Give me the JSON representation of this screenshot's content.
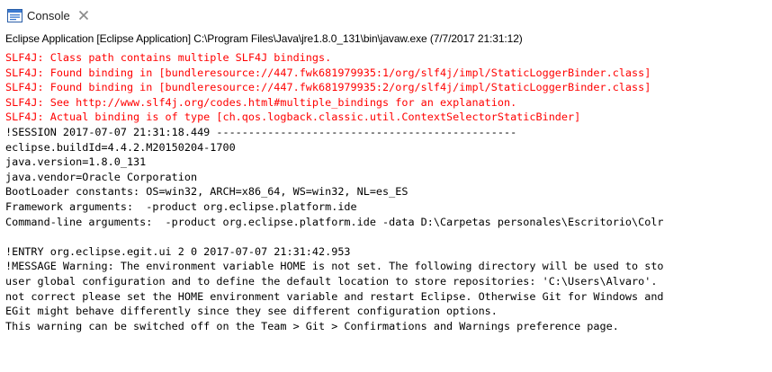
{
  "view": {
    "tab_label": "Console",
    "launch_info": "Eclipse Application [Eclipse Application] C:\\Program Files\\Java\\jre1.8.0_131\\bin\\javaw.exe (7/7/2017 21:31:12)"
  },
  "console": {
    "lines": [
      "SLF4J: Class path contains multiple SLF4J bindings.",
      "SLF4J: Found binding in [bundleresource://447.fwk681979935:1/org/slf4j/impl/StaticLoggerBinder.class]",
      "SLF4J: Found binding in [bundleresource://447.fwk681979935:2/org/slf4j/impl/StaticLoggerBinder.class]",
      "SLF4J: See http://www.slf4j.org/codes.html#multiple_bindings for an explanation.",
      "SLF4J: Actual binding is of type [ch.qos.logback.classic.util.ContextSelectorStaticBinder]",
      "!SESSION 2017-07-07 21:31:18.449 -----------------------------------------------",
      "eclipse.buildId=4.4.2.M20150204-1700",
      "java.version=1.8.0_131",
      "java.vendor=Oracle Corporation",
      "BootLoader constants: OS=win32, ARCH=x86_64, WS=win32, NL=es_ES",
      "Framework arguments:  -product org.eclipse.platform.ide",
      "Command-line arguments:  -product org.eclipse.platform.ide -data D:\\Carpetas personales\\Escritorio\\Colr",
      "",
      "!ENTRY org.eclipse.egit.ui 2 0 2017-07-07 21:31:42.953",
      "!MESSAGE Warning: The environment variable HOME is not set. The following directory will be used to sto",
      "user global configuration and to define the default location to store repositories: 'C:\\Users\\Alvaro'.",
      "not correct please set the HOME environment variable and restart Eclipse. Otherwise Git for Windows and",
      "EGit might behave differently since they see different configuration options.",
      "This warning can be switched off on the Team > Git > Confirmations and Warnings preference page."
    ],
    "line_streams": [
      "stderr",
      "stderr",
      "stderr",
      "stderr",
      "stderr",
      "stdout",
      "stdout",
      "stdout",
      "stdout",
      "stdout",
      "stdout",
      "stdout",
      "stdout",
      "stdout",
      "stdout",
      "stdout",
      "stdout",
      "stdout",
      "stdout"
    ],
    "colors": {
      "stderr": "#ff0000",
      "stdout": "#000000"
    }
  },
  "icons": {
    "tab_icon": "console-icon",
    "close_icon": "close-icon"
  }
}
